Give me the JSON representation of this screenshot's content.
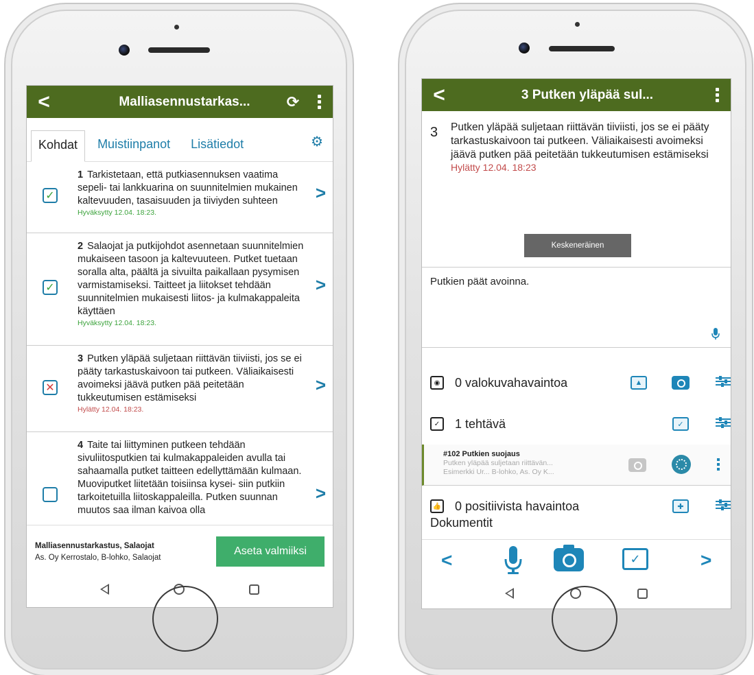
{
  "left": {
    "header": {
      "title": "Malliasennustarkas..."
    },
    "tabs": [
      "Kohdat",
      "Muistiinpanot",
      "Lisätiedot"
    ],
    "items": [
      {
        "num": "1",
        "text": "Tarkistetaan, että putkiasennuksen vaatima sepeli- tai lankkuarina on suunnitelmien mukainen kaltevuuden, tasaisuuden ja tiiviyden suhteen",
        "status": "Hyväksytty 12.04. 18:23.",
        "state": "ok"
      },
      {
        "num": "2",
        "text": "Salaojat ja putkijohdot asennetaan suunnitelmien mukaiseen tasoon ja kaltevuuteen. Putket tuetaan soralla alta, päältä ja sivuilta paikallaan pysymisen varmistamiseksi. Taitteet ja liitokset tehdään suunnitelmien mukaisesti liitos- ja kulmakappaleita käyttäen",
        "status": "Hyväksytty 12.04. 18:23.",
        "state": "ok"
      },
      {
        "num": "3",
        "text": "Putken yläpää suljetaan riittävän tiiviisti, jos se ei pääty tarkastuskaivoon tai putkeen. Väliaikaisesti avoimeksi jäävä putken pää peitetään tukkeutumisen estämiseksi",
        "status": "Hylätty 12.04. 18:23.",
        "state": "bad"
      },
      {
        "num": "4",
        "text": "Taite tai liittyminen putkeen tehdään sivuliitosputkien tai kulmakappaleiden avulla tai sahaamalla putket taitteen edellyttämään kulmaan. Muoviputket liitetään toisiinsa kysei- siin putkiin tarkoitetuilla liitoskappaleilla. Putken suunnan muutos saa ilman kaivoa olla",
        "status": "",
        "state": "none"
      }
    ],
    "footer": {
      "title": "Malliasennustarkastus, Salaojat",
      "subtitle": "As. Oy Kerrostalo, B-lohko, Salaojat",
      "button": "Aseta valmiiksi"
    }
  },
  "right": {
    "header": {
      "title": "3 Putken yläpää sul..."
    },
    "detail": {
      "num": "3",
      "text": "Putken yläpää suljetaan riittävän tiiviisti, jos se ei pääty tarkastuskaivoon tai putkeen. Väliaikaisesti avoimeksi jäävä putken pää peitetään tukkeutumisen estämiseksi",
      "status": "Hylätty 12.04. 18:23",
      "button": "Keskeneräinen"
    },
    "note": "Putkien päät avoinna.",
    "rows": {
      "photos": "0 valokuvahavaintoa",
      "tasks": "1 tehtävä",
      "positive": "0 positiivista havaintoa"
    },
    "task": {
      "title": "#102 Putkien suojaus",
      "line1": "Putken yläpää suljetaan riittävän...",
      "line2": "Esimerkki Ur... B-lohko, As. Oy K..."
    },
    "documents": "Dokumentit"
  },
  "colors": {
    "header_green": "#4d6b1f",
    "accent_blue": "#1e86b8",
    "ok_green": "#3aa23a",
    "reject_red": "#c24b4b",
    "button_green": "#3fae6b"
  },
  "icons": [
    "back-icon",
    "refresh-icon",
    "kebab-icon",
    "gear-icon",
    "checkbox-checked-icon",
    "checkbox-rejected-icon",
    "checkbox-empty-icon",
    "chevron-right-icon",
    "mic-icon",
    "camera-icon",
    "gallery-icon",
    "task-icon",
    "sliders-icon",
    "thumb-up-icon"
  ]
}
